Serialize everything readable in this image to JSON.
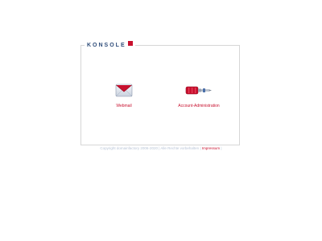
{
  "brand": {
    "name": "KONSOLE",
    "badge_color": "#c8102e"
  },
  "tiles": [
    {
      "label": "Webmail",
      "icon": "envelope-icon"
    },
    {
      "label": "Account-Administration",
      "icon": "screwdriver-icon"
    }
  ],
  "footer": {
    "copyright": "Copyright domainfactory 2006-2020",
    "powered": "Alle Rechte vorbehalten",
    "imprint": "Impressum",
    "separator": "|"
  },
  "colors": {
    "accent": "#c8102e",
    "brand_text": "#2f4d7a",
    "border": "#d6d6d6",
    "footer_text": "#b8c4d6"
  }
}
